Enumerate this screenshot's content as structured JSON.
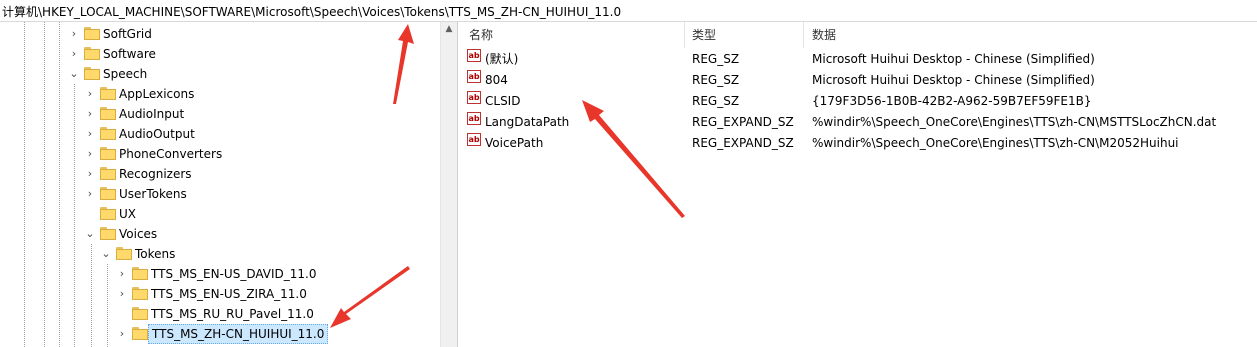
{
  "address": "计算机\\HKEY_LOCAL_MACHINE\\SOFTWARE\\Microsoft\\Speech\\Voices\\Tokens\\TTS_MS_ZH-CN_HUIHUI_11.0",
  "tree": {
    "softgrid": "SoftGrid",
    "software": "Software",
    "speech": "Speech",
    "applexicons": "AppLexicons",
    "audioinput": "AudioInput",
    "audiooutput": "AudioOutput",
    "phoneconverters": "PhoneConverters",
    "recognizers": "Recognizers",
    "usertokens": "UserTokens",
    "ux": "UX",
    "voices": "Voices",
    "tokens": "Tokens",
    "david": "TTS_MS_EN-US_DAVID_11.0",
    "zira": "TTS_MS_EN-US_ZIRA_11.0",
    "pavel": "TTS_MS_RU_RU_Pavel_11.0",
    "huihui": "TTS_MS_ZH-CN_HUIHUI_11.0"
  },
  "columns": {
    "name": "名称",
    "type": "类型",
    "data": "数据"
  },
  "values": [
    {
      "name": "(默认)",
      "type": "REG_SZ",
      "data": "Microsoft Huihui Desktop - Chinese (Simplified)"
    },
    {
      "name": "804",
      "type": "REG_SZ",
      "data": "Microsoft Huihui Desktop - Chinese (Simplified)"
    },
    {
      "name": "CLSID",
      "type": "REG_SZ",
      "data": "{179F3D56-1B0B-42B2-A962-59B7EF59FE1B}"
    },
    {
      "name": "LangDataPath",
      "type": "REG_EXPAND_SZ",
      "data": "%windir%\\Speech_OneCore\\Engines\\TTS\\zh-CN\\MSTTSLocZhCN.dat"
    },
    {
      "name": "VoicePath",
      "type": "REG_EXPAND_SZ",
      "data": "%windir%\\Speech_OneCore\\Engines\\TTS\\zh-CN\\M2052Huihui"
    }
  ],
  "icons": {
    "expand": "chevron-right-icon",
    "collapse": "chevron-down-icon",
    "value": "reg-string-icon",
    "folder": "folder-icon"
  },
  "colors": {
    "selection": "#cce8ff",
    "annotation_arrow": "#e8362a"
  }
}
